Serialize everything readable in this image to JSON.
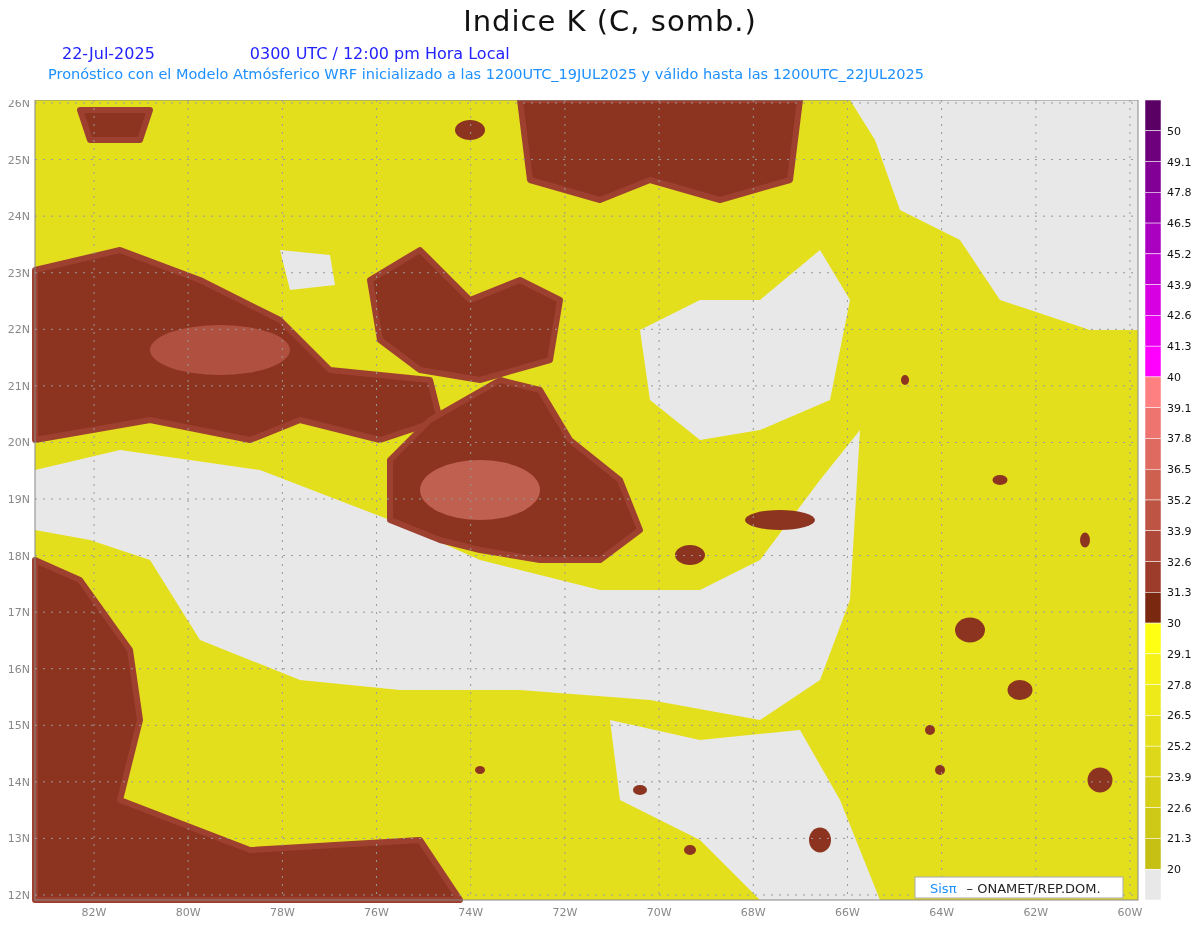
{
  "title": "Indice K (C, somb.)",
  "date": "22-Jul-2025",
  "time_line": "0300 UTC / 12:00 pm Hora Local",
  "subtitle": "Pronóstico con el Modelo Atmósferico WRF inicializado a las 1200UTC_19JUL2025 y válido hasta las  1200UTC_22JUL2025",
  "map": {
    "lat_labels": [
      "26N",
      "25N",
      "24N",
      "23N",
      "22N",
      "21N",
      "20N",
      "19N",
      "18N",
      "17N",
      "16N",
      "15N",
      "14N",
      "13N",
      "12N"
    ],
    "lon_labels": [
      "82W",
      "80W",
      "78W",
      "76W",
      "74W",
      "72W",
      "70W",
      "68W",
      "66W",
      "64W",
      "62W",
      "60W"
    ]
  },
  "colorbar": {
    "bins": [
      {
        "color": "#5a0064",
        "label": "50"
      },
      {
        "color": "#6e007e",
        "label": "49.1"
      },
      {
        "color": "#820096",
        "label": "47.8"
      },
      {
        "color": "#9600ac",
        "label": "46.5"
      },
      {
        "color": "#aa00c0",
        "label": "45.2"
      },
      {
        "color": "#c000d2",
        "label": "43.9"
      },
      {
        "color": "#d600e2",
        "label": "42.6"
      },
      {
        "color": "#ea00f0",
        "label": "41.3"
      },
      {
        "color": "#ff00ff",
        "label": "40"
      },
      {
        "color": "#ff8080",
        "label": "39.1"
      },
      {
        "color": "#ee7470",
        "label": "37.8"
      },
      {
        "color": "#de6a60",
        "label": "36.5"
      },
      {
        "color": "#ce6050",
        "label": "35.2"
      },
      {
        "color": "#be5444",
        "label": "33.9"
      },
      {
        "color": "#ae4838",
        "label": "32.6"
      },
      {
        "color": "#9e3c2c",
        "label": "31.3"
      },
      {
        "color": "#7a2810",
        "label": "30"
      },
      {
        "color": "#ffff14",
        "label": "29.1"
      },
      {
        "color": "#f6f218",
        "label": "27.8"
      },
      {
        "color": "#eeea1a",
        "label": "26.5"
      },
      {
        "color": "#e6e01a",
        "label": "25.2"
      },
      {
        "color": "#ded81a",
        "label": "23.9"
      },
      {
        "color": "#d6d018",
        "label": "22.6"
      },
      {
        "color": "#cec816",
        "label": "21.3"
      },
      {
        "color": "#c6c014",
        "label": "20"
      },
      {
        "color": "#e8e8e8"
      }
    ]
  },
  "credit": {
    "brand": "Sisπ",
    "text": "– ONAMET/REP.DOM."
  }
}
